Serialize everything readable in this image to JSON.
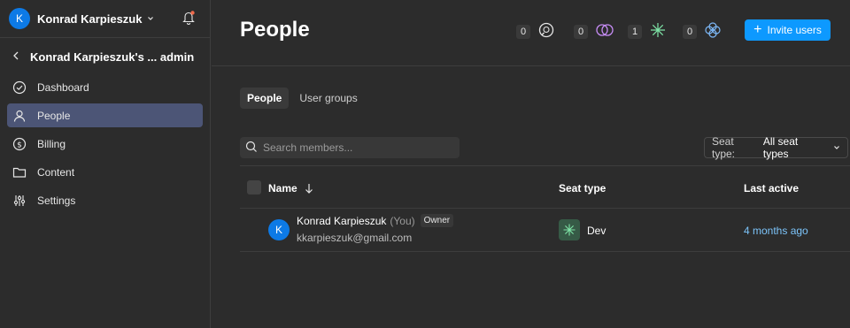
{
  "sidebar": {
    "avatar_letter": "K",
    "account_name": "Konrad Karpieszuk",
    "org_title": "Konrad Karpieszuk's ... admin",
    "items": [
      {
        "label": "Dashboard",
        "icon": "check-circle-icon"
      },
      {
        "label": "People",
        "icon": "person-icon",
        "active": true
      },
      {
        "label": "Billing",
        "icon": "dollar-icon"
      },
      {
        "label": "Content",
        "icon": "folder-icon"
      },
      {
        "label": "Settings",
        "icon": "sliders-icon"
      }
    ]
  },
  "header": {
    "title": "People",
    "counters": [
      {
        "count": "0",
        "icon": "chat-circle-icon"
      },
      {
        "count": "0",
        "icon": "rings-icon"
      },
      {
        "count": "1",
        "icon": "asterisk-icon"
      },
      {
        "count": "0",
        "icon": "clover-icon"
      }
    ],
    "invite_label": "Invite users"
  },
  "tabs": [
    "People",
    "User groups"
  ],
  "search": {
    "placeholder": "Search members..."
  },
  "seat_filter": {
    "label": "Seat type:",
    "value": "All seat types"
  },
  "table": {
    "columns": {
      "name": "Name",
      "seat": "Seat type",
      "last": "Last active"
    },
    "rows": [
      {
        "avatar_letter": "K",
        "name": "Konrad Karpieszuk",
        "you": "(You)",
        "badge": "Owner",
        "email": "kkarpieszuk@gmail.com",
        "seat_type": "Dev",
        "last_active": "4 months ago"
      }
    ]
  },
  "colors": {
    "accent": "#0d99ff",
    "active_nav": "#4c5576",
    "link": "#7cc4fa",
    "dev_seat": "#365a46"
  }
}
